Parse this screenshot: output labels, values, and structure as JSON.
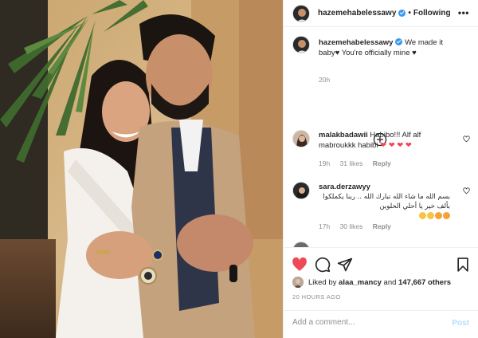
{
  "post": {
    "username": "hazemehabelessawy",
    "follow_label": "Following",
    "more_label": "•••",
    "caption": "We made it baby♥ You're officially mine ♥",
    "caption_time": "20h"
  },
  "comments": [
    {
      "username": "malakbadawii",
      "text": "Habibo!!! Alf alf mabroukkk habibi",
      "time": "19h",
      "likes": "31 likes",
      "reply": "Reply"
    },
    {
      "username": "sara.derzawyy",
      "text": "بسم الله ما شاء الله تبارك الله .. ربنا يكملكوا بألف خير يا أحلي الحلوين",
      "time": "17h",
      "likes": "30 likes",
      "reply": "Reply"
    }
  ],
  "likes": {
    "prefix": "Liked by",
    "user": "alaa_mancy",
    "joiner": "and",
    "count": "147,667 others"
  },
  "timestamp": "20 HOURS AGO",
  "add_comment": {
    "placeholder": "Add a comment...",
    "post_label": "Post"
  },
  "icons": {
    "like": "heart-filled-icon",
    "comment": "comment-bubble-icon",
    "share": "paper-plane-icon",
    "save": "bookmark-icon",
    "load_more": "plus-circle-icon",
    "verified": "verified-badge-icon"
  },
  "colors": {
    "like_red": "#ed4956",
    "verified_blue": "#3897f0",
    "post_disabled": "#b2dffc",
    "muted_text": "#8e8e8e"
  }
}
